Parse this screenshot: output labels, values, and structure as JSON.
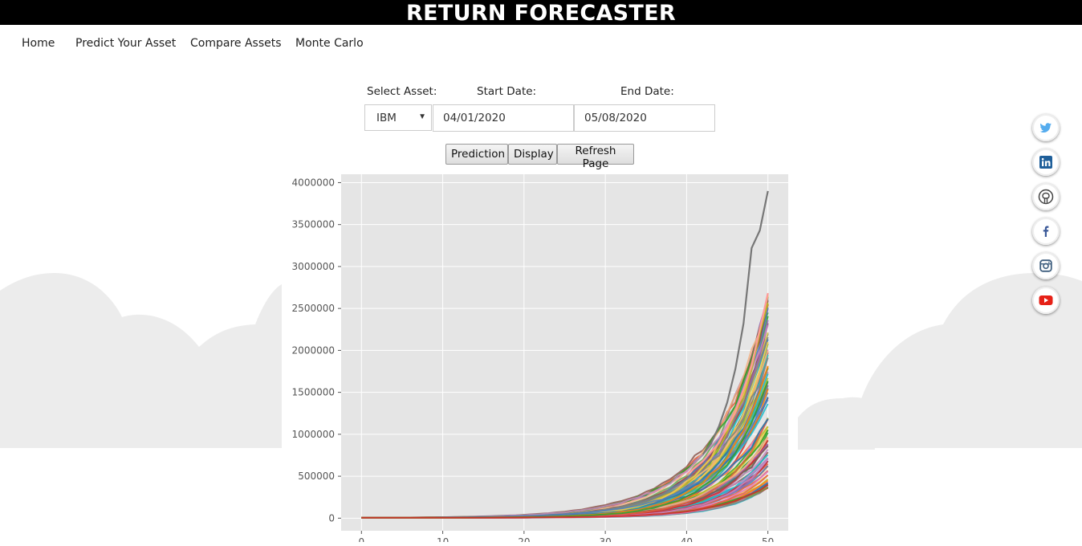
{
  "header": {
    "title": "RETURN FORECASTER"
  },
  "nav": {
    "items": [
      "Home",
      "Predict Your Asset",
      "Compare Assets",
      "Monte Carlo"
    ]
  },
  "form": {
    "asset_label": "Select Asset:",
    "start_label": "Start Date:",
    "end_label": "End Date:",
    "asset_value": "IBM",
    "start_value": "04/01/2020",
    "end_value": "05/08/2020",
    "buttons": {
      "prediction": "Prediction",
      "display": "Display",
      "refresh": "Refresh Page"
    }
  },
  "social": [
    "twitter-icon",
    "linkedin-icon",
    "github-icon",
    "facebook-icon",
    "instagram-icon",
    "youtube-icon"
  ],
  "chart_data": {
    "type": "line",
    "title": "",
    "xlabel": "",
    "ylabel": "",
    "grid": true,
    "background": "#e5e5e5",
    "xlim": [
      -2.5,
      52.5
    ],
    "ylim": [
      -150000,
      4100000
    ],
    "x_ticks": [
      "0",
      "10",
      "20",
      "30",
      "40",
      "50"
    ],
    "y_ticks": [
      "0",
      "500000",
      "1000000",
      "1500000",
      "2000000",
      "2500000",
      "3000000",
      "3500000",
      "4000000"
    ],
    "simulation_count_approx": 100,
    "highlighted_series": [
      {
        "color": "#777777",
        "x": [
          42,
          43,
          44,
          45,
          46,
          47,
          48,
          49,
          50
        ],
        "values": [
          760000,
          890000,
          1100000,
          1380000,
          1780000,
          2320000,
          3220000,
          3430000,
          3900000
        ]
      },
      {
        "color": "#ff9999",
        "x": [
          40,
          42,
          44,
          46,
          48,
          50
        ],
        "values": [
          520000,
          680000,
          900000,
          1260000,
          1820000,
          2680000
        ]
      }
    ],
    "final_value_range": [
      360000,
      3900000
    ]
  }
}
